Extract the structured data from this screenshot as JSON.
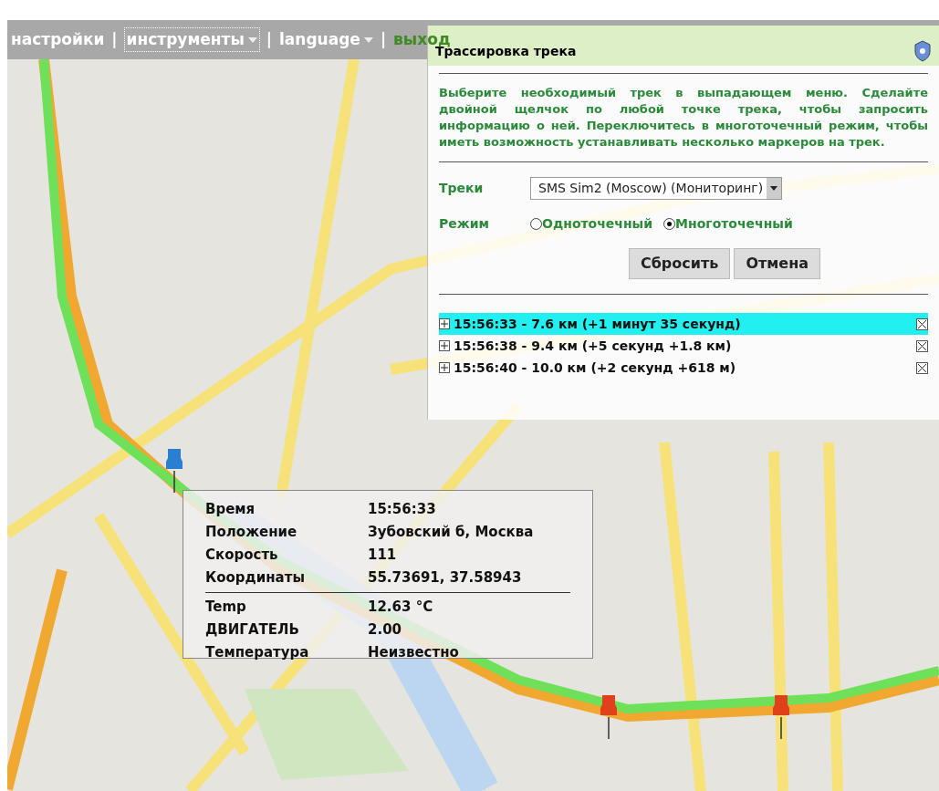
{
  "menu": [
    {
      "label": "настройки",
      "dropdown": false,
      "focused": false
    },
    {
      "label": "инструменты",
      "dropdown": true,
      "focused": true
    },
    {
      "label": "language",
      "dropdown": true,
      "focused": false
    },
    {
      "label": "выход",
      "dropdown": false,
      "focused": false
    }
  ],
  "menu_separators": [
    "|",
    "|",
    "|"
  ],
  "panel": {
    "title": "Трассировка трека",
    "instructions": "Выберите необходимый трек в выпадающем меню. Сделайте двойной щелчок по любой точке трека, чтобы запросить информацию о ней. Переключитесь в многоточечный режим, чтобы иметь возможность устанавливать несколько маркеров на трек.",
    "tracks_label": "Треки",
    "track_select": "SMS Sim2 (Moscow) (Мониторинг)",
    "mode_label": "Режим",
    "modes": [
      {
        "label": "Одноточечный",
        "selected": false
      },
      {
        "label": "Многоточечный",
        "selected": true
      }
    ],
    "buttons": [
      "Сбросить",
      "Отмена"
    ],
    "points": [
      {
        "text": "15:56:33 - 7.6 км (+1 минут 35 секунд)",
        "selected": true
      },
      {
        "text": "15:56:38 - 9.4 км (+5 секунд +1.8 км)",
        "selected": false
      },
      {
        "text": "15:56:40 - 10.0 км (+2 секунд +618 м)",
        "selected": false
      }
    ]
  },
  "info": {
    "main_rows": [
      {
        "label": "Время",
        "value": "15:56:33"
      },
      {
        "label": "Положение",
        "value": "Зубовский б, Москва"
      },
      {
        "label": "Скорость",
        "value": "111"
      },
      {
        "label": "Координаты",
        "value": "55.73691, 37.58943"
      }
    ],
    "sensor_rows": [
      {
        "label": "Temp",
        "value": "12.63 °C"
      },
      {
        "label": "ДВИГАТЕЛЬ",
        "value": "2.00"
      },
      {
        "label": "Температура",
        "value": "Неизвестно"
      }
    ]
  },
  "pins": [
    {
      "color": "#2a7fd0"
    },
    {
      "color": "#e0401a"
    },
    {
      "color": "#e0401a"
    }
  ]
}
